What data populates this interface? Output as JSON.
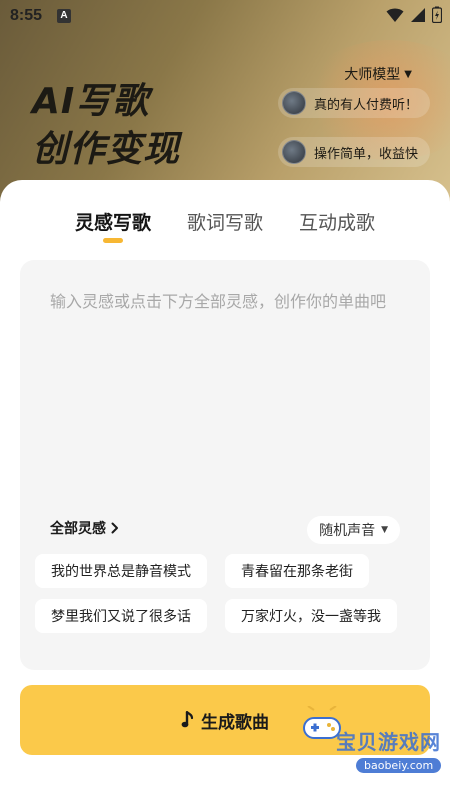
{
  "status_bar": {
    "time": "8:55",
    "notification_icon": "A"
  },
  "banner": {
    "title_line1": "AI写歌",
    "title_line2": "创作变现",
    "model_select": "大师模型",
    "bubbles": [
      {
        "text": "真的有人付费听！"
      },
      {
        "text": "操作简单，收益快"
      }
    ]
  },
  "tabs": [
    {
      "label": "灵感写歌",
      "active": true
    },
    {
      "label": "歌词写歌",
      "active": false
    },
    {
      "label": "互动成歌",
      "active": false
    }
  ],
  "input": {
    "placeholder": "输入灵感或点击下方全部灵感，创作你的单曲吧"
  },
  "inspiration": {
    "all_link": "全部灵感",
    "voice_select": "随机声音",
    "chips": [
      "我的世界总是静音模式",
      "青春留在那条老街",
      "梦里我们又说了很多话",
      "万家灯火，没一盏等我"
    ]
  },
  "generate_button": "生成歌曲",
  "watermark": {
    "text": "宝贝游戏网",
    "url": "baobeiy.com"
  },
  "colors": {
    "accent": "#fbc94a",
    "tab_underline": "#f7b733"
  }
}
